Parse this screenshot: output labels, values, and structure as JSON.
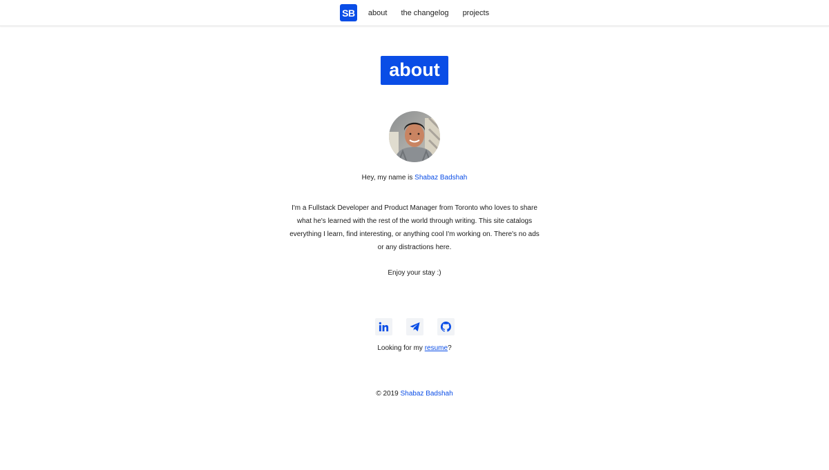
{
  "nav": {
    "logo": "SB",
    "links": [
      "about",
      "the changelog",
      "projects"
    ]
  },
  "page": {
    "title": "about"
  },
  "intro": {
    "prefix": "Hey, my name is ",
    "name": "Shabaz Badshah"
  },
  "bio": {
    "text": "I'm a Fullstack Developer and Product Manager from Toronto who loves to share what he's learned with the rest of the world through writing. This site catalogs everything I learn, find interesting, or anything cool I'm working on. There's no ads or any distractions here.",
    "closing": "Enjoy your stay :)"
  },
  "socials": {
    "icons": [
      "linkedin-icon",
      "telegram-icon",
      "github-icon"
    ]
  },
  "resume": {
    "prefix": "Looking for my ",
    "link": "resume",
    "suffix": "?"
  },
  "footer": {
    "copyright": "© 2019 ",
    "name": "Shabaz Badshah"
  },
  "colors": {
    "accent": "#0a4de6",
    "text": "#1a1a1a",
    "social_bg": "#f1f3f6"
  }
}
